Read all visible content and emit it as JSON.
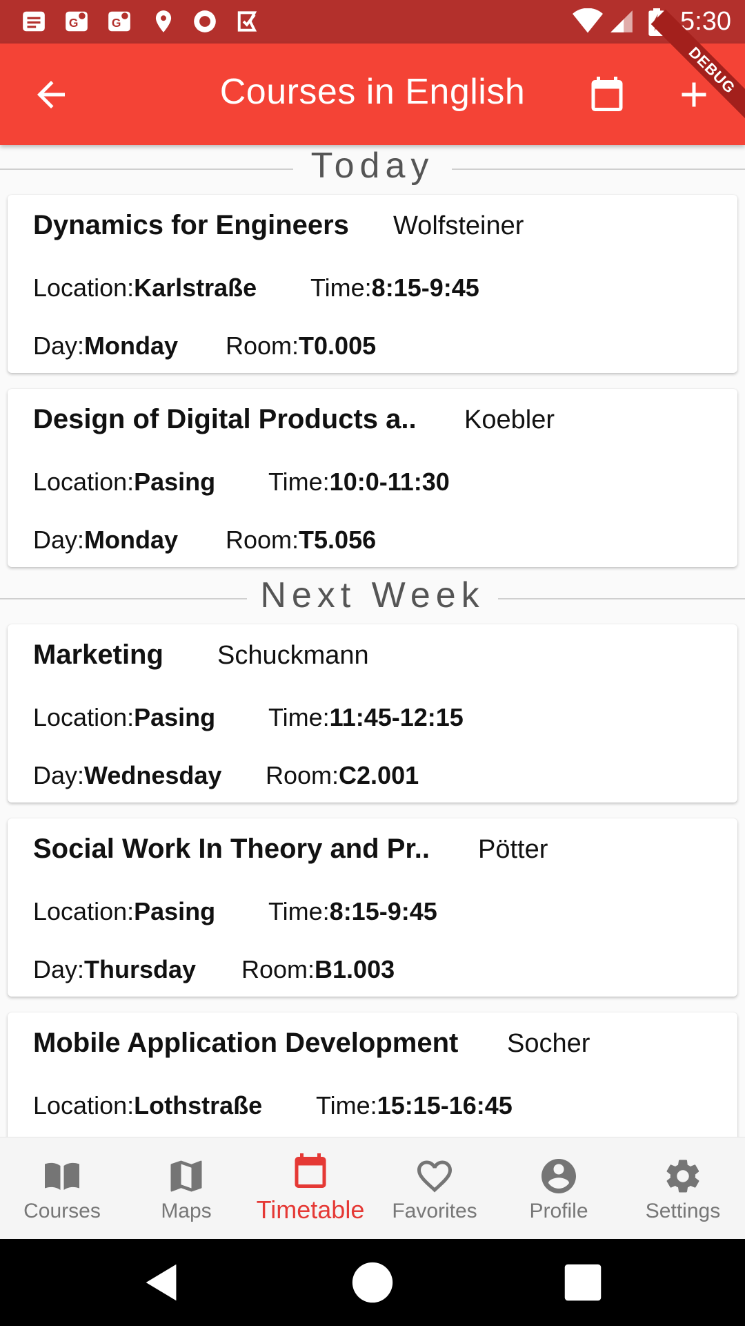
{
  "status_bar": {
    "time": "5:30",
    "icons": [
      "notification-icon",
      "maps-icon",
      "maps-icon",
      "location-icon",
      "record-icon",
      "checklist-icon",
      "wifi-icon",
      "signal-icon",
      "battery-charging-icon"
    ]
  },
  "app_bar": {
    "title": "Courses in English",
    "debug_banner": "DEBUG",
    "actions": [
      "back-icon",
      "calendar-icon",
      "add-icon"
    ]
  },
  "sections": [
    {
      "label": "Today"
    },
    {
      "label": "Next Week"
    }
  ],
  "field_labels": {
    "location": "Location:",
    "time": "Time:",
    "day": "Day:",
    "room": "Room:"
  },
  "courses": [
    {
      "name": "Dynamics for Engineers",
      "professor": "Wolfsteiner",
      "location": "Karlstraße",
      "time": "8:15-9:45",
      "day": "Monday",
      "room": "T0.005"
    },
    {
      "name": "Design of Digital Products a..",
      "professor": "Koebler",
      "location": "Pasing",
      "time": "10:0-11:30",
      "day": "Monday",
      "room": "T5.056"
    },
    {
      "name": "Marketing",
      "professor": "Schuckmann",
      "location": "Pasing",
      "time": "11:45-12:15",
      "day": "Wednesday",
      "room": "C2.001"
    },
    {
      "name": "Social Work In Theory and Pr..",
      "professor": "Pötter",
      "location": "Pasing",
      "time": "8:15-9:45",
      "day": "Thursday",
      "room": "B1.003"
    },
    {
      "name": "Mobile Application Development",
      "professor": "Socher",
      "location": "Lothstraße",
      "time": "15:15-16:45",
      "day": "",
      "room": ""
    }
  ],
  "bottom_nav": {
    "items": [
      {
        "label": "Courses",
        "icon": "book-icon"
      },
      {
        "label": "Maps",
        "icon": "map-icon"
      },
      {
        "label": "Timetable",
        "icon": "calendar-icon"
      },
      {
        "label": "Favorites",
        "icon": "heart-icon"
      },
      {
        "label": "Profile",
        "icon": "account-icon"
      },
      {
        "label": "Settings",
        "icon": "gear-icon"
      }
    ],
    "active": "Timetable"
  },
  "colors": {
    "primary": "#f44336",
    "status_bar": "#b3302c",
    "active_nav": "#e53935",
    "inactive_nav": "#757575"
  }
}
